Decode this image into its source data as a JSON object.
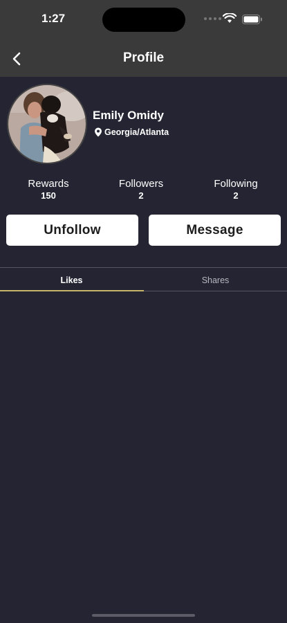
{
  "status_bar": {
    "time": "1:27"
  },
  "nav": {
    "title": "Profile"
  },
  "profile": {
    "name": "Emily Omidy",
    "location": "Georgia/Atlanta"
  },
  "stats": [
    {
      "label": "Rewards",
      "value": "150"
    },
    {
      "label": "Followers",
      "value": "2"
    },
    {
      "label": "Following",
      "value": "2"
    }
  ],
  "actions": {
    "unfollow_label": "Unfollow",
    "message_label": "Message"
  },
  "tabs": [
    {
      "label": "Likes",
      "active": true
    },
    {
      "label": "Shares",
      "active": false
    }
  ],
  "colors": {
    "background": "#252433",
    "header": "#3a3a3a",
    "accent": "#c9b66b"
  }
}
